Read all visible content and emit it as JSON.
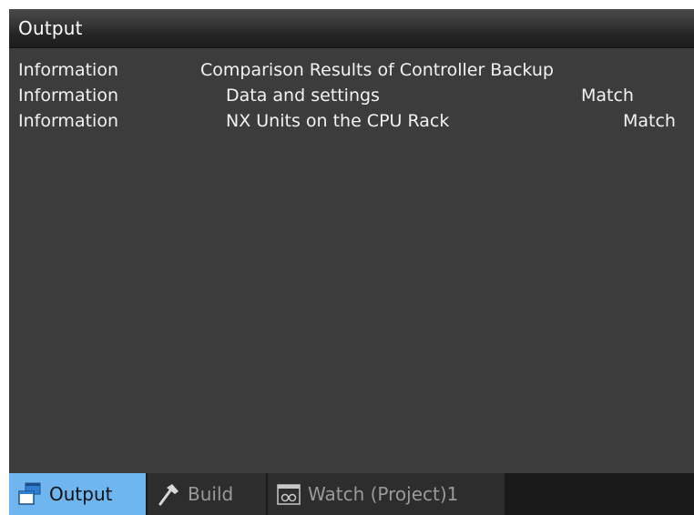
{
  "panel": {
    "title": "Output"
  },
  "output": {
    "rows": [
      {
        "type": "Information",
        "message": "Comparison Results of Controller Backup",
        "result": ""
      },
      {
        "type": "Information",
        "message": "Data and settings",
        "result": "Match"
      },
      {
        "type": "Information",
        "message": "NX Units on the CPU Rack",
        "result": "Match"
      }
    ]
  },
  "tabs": [
    {
      "label": "Output",
      "icon": "output-window-icon",
      "active": true
    },
    {
      "label": "Build",
      "icon": "hammer-icon",
      "active": false
    },
    {
      "label": "Watch (Project)1",
      "icon": "watch-window-icon",
      "active": false
    }
  ],
  "colors": {
    "panel_bg": "#3c3c3c",
    "active_tab": "#6fb6f0",
    "text": "#f2f2f2"
  }
}
